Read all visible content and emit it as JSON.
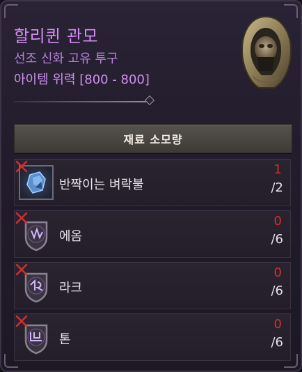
{
  "item": {
    "name": "할리퀸 관모",
    "type": "선조 신화 고유 투구",
    "power": "아이템 위력 [800 - 800]",
    "icon": "hooded-helm-icon"
  },
  "materials": {
    "header": "재료 소모량",
    "rows": [
      {
        "name": "반짝이는 벼락불",
        "have": "1",
        "need": "/2",
        "icon": "crystal-icon",
        "status": "insufficient"
      },
      {
        "name": "에옴",
        "have": "0",
        "need": "/6",
        "icon": "rune-eom-icon",
        "status": "insufficient"
      },
      {
        "name": "라크",
        "have": "0",
        "need": "/6",
        "icon": "rune-rak-icon",
        "status": "insufficient"
      },
      {
        "name": "톤",
        "have": "0",
        "need": "/6",
        "icon": "rune-ton-icon",
        "status": "insufficient"
      }
    ]
  },
  "colors": {
    "title": "#d58cf2",
    "missing": "#d22e2e"
  }
}
